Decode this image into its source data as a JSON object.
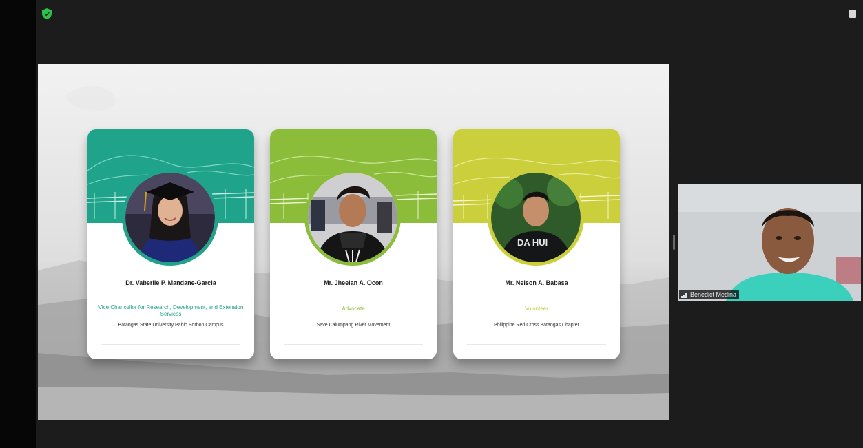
{
  "slide": {
    "cards": [
      {
        "name": "Dr. Vaberlie P. Mandane-Garcia",
        "role": "Vice Chancellor for Research, Development, and Extension Services",
        "org": "Batangas State University Pablo Borbon Campus",
        "accent": "#1fa38b",
        "photo_subject": "woman-in-graduation-cap"
      },
      {
        "name": "Mr. Jheelan A. Ocon",
        "role": "Advocate",
        "org": "Save Calumpang River Movement",
        "accent": "#8bbd3a",
        "photo_subject": "young-man-with-scarf"
      },
      {
        "name": "Mr. Nelson A. Babasa",
        "role": "Volunteer",
        "org": "Philippine Red Cross Batangas Chapter",
        "accent": "#cbcf3c",
        "photo_subject": "man-in-black-shirt"
      }
    ]
  },
  "participant": {
    "name": "Benedict Medina",
    "signal_icon": "signal-bars-icon"
  },
  "toolbar": {
    "security_icon": "shield-icon",
    "view_icon": "view-options-icon"
  },
  "colors": {
    "card1_header": "#1fa38b",
    "card2_header": "#8bbd3a",
    "card3_header": "#cbcf3c",
    "meeting_bg": "#1c1c1c"
  }
}
